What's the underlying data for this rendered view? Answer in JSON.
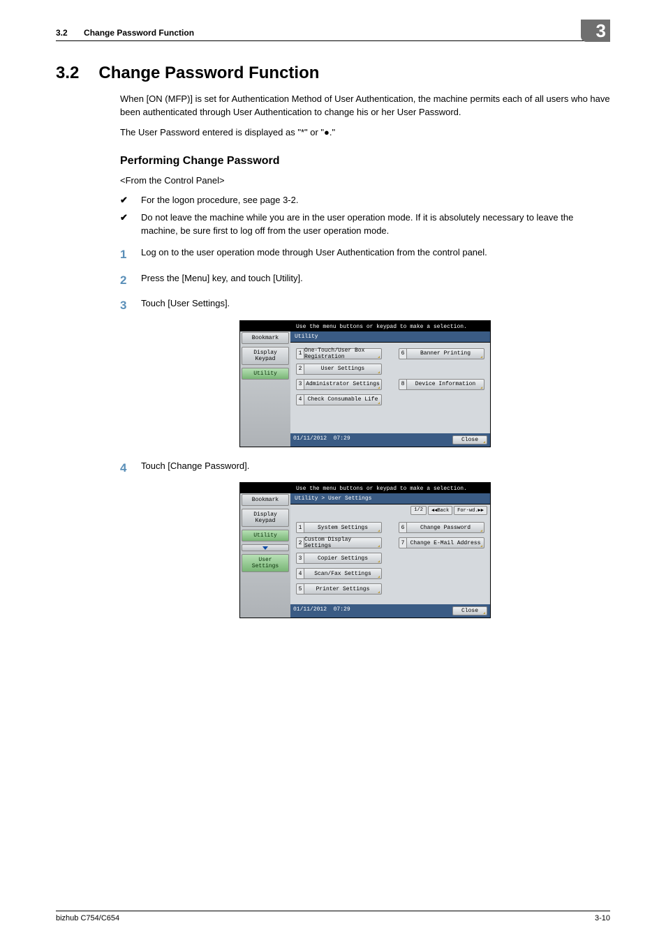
{
  "header": {
    "section_number": "3.2",
    "section_name": "Change Password Function",
    "chapter_badge": "3"
  },
  "title": {
    "number": "3.2",
    "text": "Change Password Function"
  },
  "intro_paragraph": "When [ON (MFP)] is set for Authentication Method of User Authentication, the machine permits each of all users who have been authenticated through User Authentication to change his or her User Password.",
  "display_note": "The User Password entered is displayed as \"*\" or \"●.\"",
  "subheading": "Performing Change Password",
  "from_note": "<From the Control Panel>",
  "checks": [
    "For the logon procedure, see page 3-2.",
    "Do not leave the machine while you are in the user operation mode. If it is absolutely necessary to leave the machine, be sure first to log off from the user operation mode."
  ],
  "steps": [
    "Log on to the user operation mode through User Authentication from the control panel.",
    "Press the [Menu] key, and touch [Utility].",
    "Touch [User Settings].",
    "Touch [Change Password]."
  ],
  "check_mark": "✔",
  "step_numbers": [
    "1",
    "2",
    "3",
    "4"
  ],
  "screen1": {
    "prompt": "Use the menu buttons or keypad to make a selection.",
    "breadcrumb": "Utility",
    "sidebar": [
      "Bookmark",
      "Display Keypad",
      "Utility"
    ],
    "left_items": [
      {
        "n": "1",
        "l": "One-Touch/User Box Registration"
      },
      {
        "n": "2",
        "l": "User Settings"
      },
      {
        "n": "3",
        "l": "Administrator Settings"
      },
      {
        "n": "4",
        "l": "Check Consumable Life"
      }
    ],
    "right_items": [
      {
        "n": "6",
        "l": "Banner Printing"
      },
      {
        "n": "",
        "l": ""
      },
      {
        "n": "8",
        "l": "Device Information"
      }
    ],
    "date": "01/11/2012",
    "time": "07:29",
    "close": "Close"
  },
  "screen2": {
    "prompt": "Use the menu buttons or keypad to make a selection.",
    "breadcrumb": "Utility > User Settings",
    "page_indicator": "1/2",
    "back": "◀◀Back",
    "forw": "For-wd.▶▶",
    "sidebar_top": [
      "Bookmark",
      "Display Keypad"
    ],
    "sidebar_active": "Utility",
    "sidebar_sub": "User Settings",
    "left_items": [
      {
        "n": "1",
        "l": "System Settings"
      },
      {
        "n": "2",
        "l": "Custom Display Settings"
      },
      {
        "n": "3",
        "l": "Copier Settings"
      },
      {
        "n": "4",
        "l": "Scan/Fax Settings"
      },
      {
        "n": "5",
        "l": "Printer Settings"
      }
    ],
    "right_items": [
      {
        "n": "6",
        "l": "Change Password"
      },
      {
        "n": "7",
        "l": "Change E-Mail Address"
      }
    ],
    "date": "01/11/2012",
    "time": "07:29",
    "close": "Close"
  },
  "footer": {
    "left": "bizhub C754/C654",
    "right": "3-10"
  }
}
